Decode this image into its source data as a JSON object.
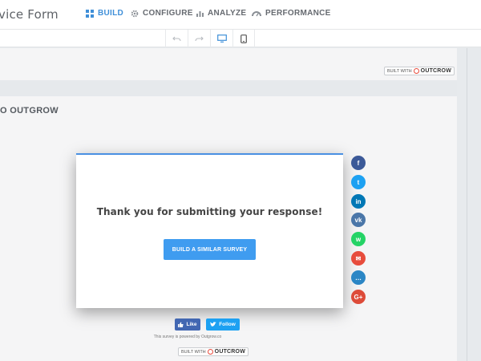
{
  "app": {
    "title": "vice Form"
  },
  "nav": {
    "items": [
      {
        "label": "BUILD",
        "icon": "build-grid-icon",
        "active": true
      },
      {
        "label": "CONFIGURE",
        "icon": "gear-icon",
        "active": false
      },
      {
        "label": "ANALYZE",
        "icon": "bar-chart-icon",
        "active": false
      },
      {
        "label": "PERFORMANCE",
        "icon": "speedometer-icon",
        "active": false
      }
    ]
  },
  "toolbar": {
    "buttons": [
      {
        "icon": "undo-icon"
      },
      {
        "icon": "redo-icon"
      },
      {
        "icon": "desktop-preview-icon",
        "active": true
      },
      {
        "icon": "mobile-preview-icon"
      }
    ]
  },
  "badge": {
    "prefix": "BUILT WITH",
    "brand": "OUTCROW"
  },
  "page": {
    "brand_heading": "O OUTGROW"
  },
  "modal": {
    "message": "Thank you for submitting your response!",
    "cta_label": "BUILD A SIMILAR SURVEY"
  },
  "share": {
    "icons": [
      {
        "name": "facebook-share-icon",
        "glyph": "f",
        "color": "#3b5998"
      },
      {
        "name": "twitter-share-icon",
        "glyph": "t",
        "color": "#1da1f2"
      },
      {
        "name": "linkedin-share-icon",
        "glyph": "in",
        "color": "#0077b5"
      },
      {
        "name": "vk-share-icon",
        "glyph": "vk",
        "color": "#4a76a8"
      },
      {
        "name": "whatsapp-share-icon",
        "glyph": "w",
        "color": "#25d366"
      },
      {
        "name": "email-share-icon",
        "glyph": "✉",
        "color": "#e74c3c"
      },
      {
        "name": "chat-share-icon",
        "glyph": "…",
        "color": "#2b86c5"
      },
      {
        "name": "googleplus-share-icon",
        "glyph": "G+",
        "color": "#dd4b39"
      }
    ]
  },
  "footer": {
    "like_label": "Like",
    "follow_label": "Follow",
    "powered_text": "This survey is powered by Outgrow.co"
  },
  "colors": {
    "accent": "#3f8fd8",
    "cta": "#3f9cf0",
    "facebook": "#4267b2",
    "twitter": "#1da1f2"
  }
}
